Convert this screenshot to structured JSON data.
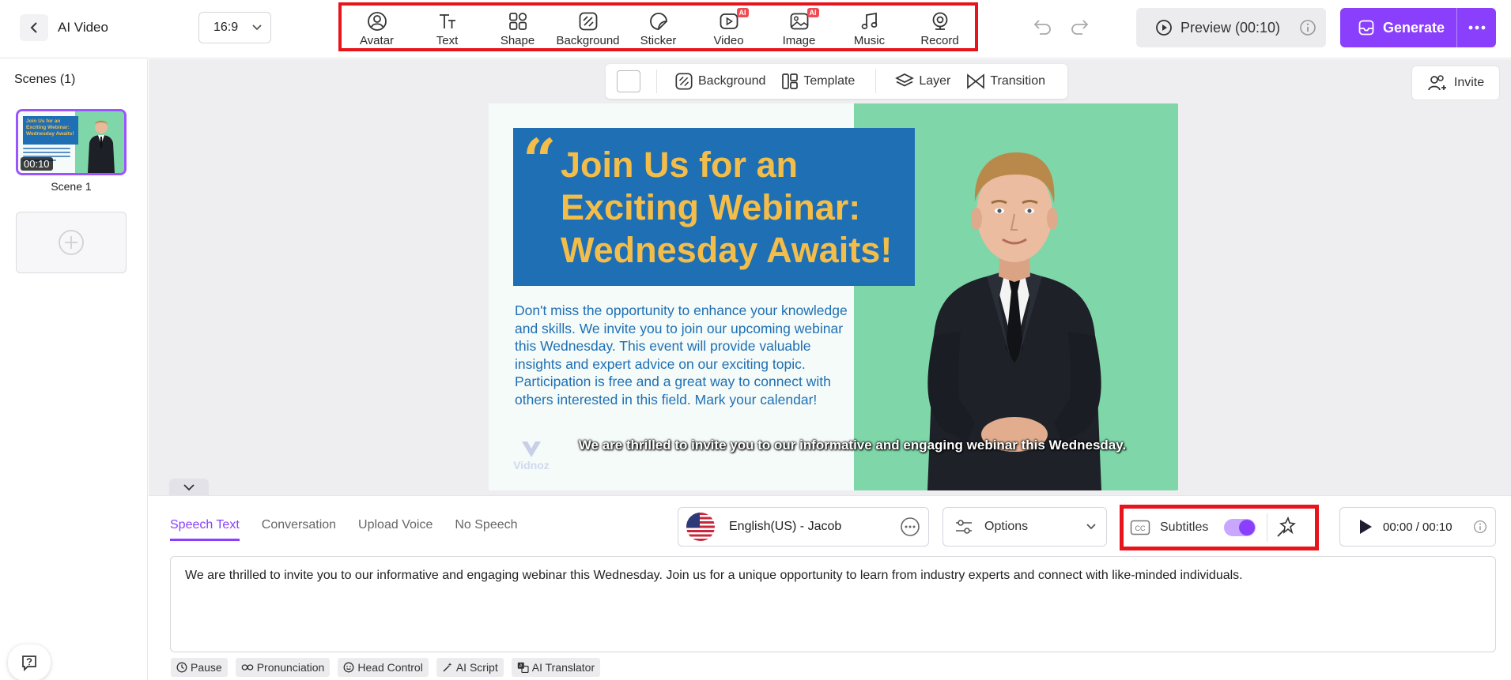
{
  "header": {
    "app_title": "AI Video",
    "aspect_ratio": "16:9",
    "tools": [
      {
        "label": "Avatar",
        "icon": "avatar-icon",
        "ai": false
      },
      {
        "label": "Text",
        "icon": "text-icon",
        "ai": false
      },
      {
        "label": "Shape",
        "icon": "shape-icon",
        "ai": false
      },
      {
        "label": "Background",
        "icon": "background-icon",
        "ai": false
      },
      {
        "label": "Sticker",
        "icon": "sticker-icon",
        "ai": false
      },
      {
        "label": "Video",
        "icon": "video-icon",
        "ai": true
      },
      {
        "label": "Image",
        "icon": "image-icon",
        "ai": true
      },
      {
        "label": "Music",
        "icon": "music-icon",
        "ai": false
      },
      {
        "label": "Record",
        "icon": "record-icon",
        "ai": false
      }
    ],
    "ai_badge": "AI",
    "preview_label": "Preview (00:10)",
    "generate_label": "Generate"
  },
  "scenes": {
    "title": "Scenes (1)",
    "items": [
      {
        "name": "Scene 1",
        "duration": "00:10",
        "thumb_title": "Join Us for an Exciting Webinar: Wednesday Awaits!"
      }
    ]
  },
  "canvas_toolbar": {
    "background_label": "Background",
    "template_label": "Template",
    "layer_label": "Layer",
    "transition_label": "Transition"
  },
  "invite_label": "Invite",
  "slide": {
    "headline": "Join Us for an Exciting Webinar: Wednesday Awaits!",
    "body": "Don't miss the opportunity to enhance your knowledge and skills. We invite you to join our upcoming webinar this Wednesday. This event will provide valuable insights and expert advice on our exciting topic. Participation is free and a great way to connect with others interested in this field. Mark your calendar!",
    "watermark": "Vidnoz",
    "subtitle": "We are thrilled to invite you to our informative and engaging webinar this Wednesday."
  },
  "bottom": {
    "tabs": [
      {
        "label": "Speech Text",
        "active": true
      },
      {
        "label": "Conversation",
        "active": false
      },
      {
        "label": "Upload Voice",
        "active": false
      },
      {
        "label": "No Speech",
        "active": false
      }
    ],
    "voice": "English(US) - Jacob",
    "options_label": "Options",
    "subtitles_label": "Subtitles",
    "subtitles_on": true,
    "time": "00:00 / 00:10",
    "speech_text": "We are thrilled to invite you to our informative and engaging webinar this Wednesday. Join us for a unique opportunity to learn from industry experts and connect with like-minded individuals.",
    "chips": [
      {
        "label": "Pause",
        "icon": "clock-icon"
      },
      {
        "label": "Pronunciation",
        "icon": "pronunciation-icon"
      },
      {
        "label": "Head Control",
        "icon": "smile-icon"
      },
      {
        "label": "AI Script",
        "icon": "magic-wand-icon"
      },
      {
        "label": "AI Translator",
        "icon": "translate-icon"
      }
    ]
  },
  "colors": {
    "accent": "#8a3ffc",
    "highlight": "#e8141c",
    "slide_blue": "#1f6fb5",
    "slide_yellow": "#f3bd4a",
    "slide_green": "#7fd6a8"
  }
}
